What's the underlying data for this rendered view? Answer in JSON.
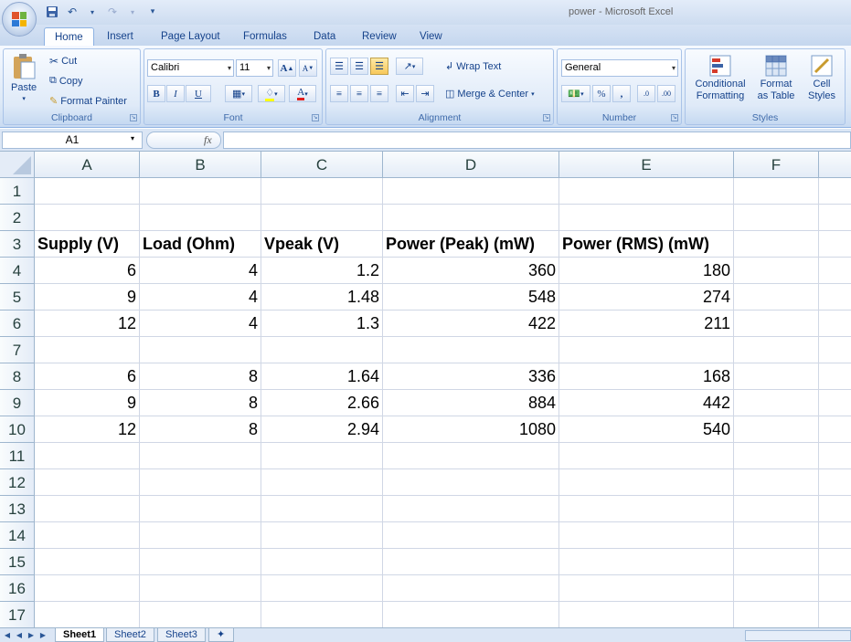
{
  "app": {
    "title": "power - Microsoft Excel"
  },
  "qat": {
    "save_icon": "save-icon",
    "undo_icon": "undo-icon",
    "redo_icon": "redo-icon"
  },
  "tabs": [
    "Home",
    "Insert",
    "Page Layout",
    "Formulas",
    "Data",
    "Review",
    "View"
  ],
  "active_tab": "Home",
  "clipboard": {
    "paste": "Paste",
    "cut": "Cut",
    "copy": "Copy",
    "format_painter": "Format Painter",
    "label": "Clipboard"
  },
  "font": {
    "name": "Calibri",
    "size": "11",
    "label": "Font",
    "bold": "B",
    "italic": "I",
    "underline": "U",
    "grow": "A",
    "shrink": "A"
  },
  "alignment": {
    "wrap_text": "Wrap Text",
    "merge_center": "Merge & Center",
    "label": "Alignment"
  },
  "number": {
    "format": "General",
    "percent": "%",
    "comma": ",",
    "label": "Number"
  },
  "styles": {
    "conditional": "Conditional",
    "conditional2": "Formatting",
    "format": "Format",
    "format2": "as Table",
    "cell": "Cell",
    "cell2": "Styles",
    "label": "Styles"
  },
  "formula_bar": {
    "name_box": "A1",
    "fx": "fx",
    "formula": ""
  },
  "columns": [
    "A",
    "B",
    "C",
    "D",
    "E",
    "F"
  ],
  "rows": [
    "1",
    "2",
    "3",
    "4",
    "5",
    "6",
    "7",
    "8",
    "9",
    "10",
    "11",
    "12",
    "13",
    "14",
    "15",
    "16",
    "17"
  ],
  "cells": {
    "r3": [
      "Supply (V)",
      "Load (Ohm)",
      "Vpeak (V)",
      "Power (Peak) (mW)",
      "Power (RMS) (mW)"
    ],
    "r4": [
      "6",
      "4",
      "1.2",
      "360",
      "180"
    ],
    "r5": [
      "9",
      "4",
      "1.48",
      "548",
      "274"
    ],
    "r6": [
      "12",
      "4",
      "1.3",
      "422",
      "211"
    ],
    "r8": [
      "6",
      "8",
      "1.64",
      "336",
      "168"
    ],
    "r9": [
      "9",
      "8",
      "2.66",
      "884",
      "442"
    ],
    "r10": [
      "12",
      "8",
      "2.94",
      "1080",
      "540"
    ]
  },
  "sheets": [
    "Sheet1",
    "Sheet2",
    "Sheet3"
  ],
  "active_sheet": "Sheet1"
}
